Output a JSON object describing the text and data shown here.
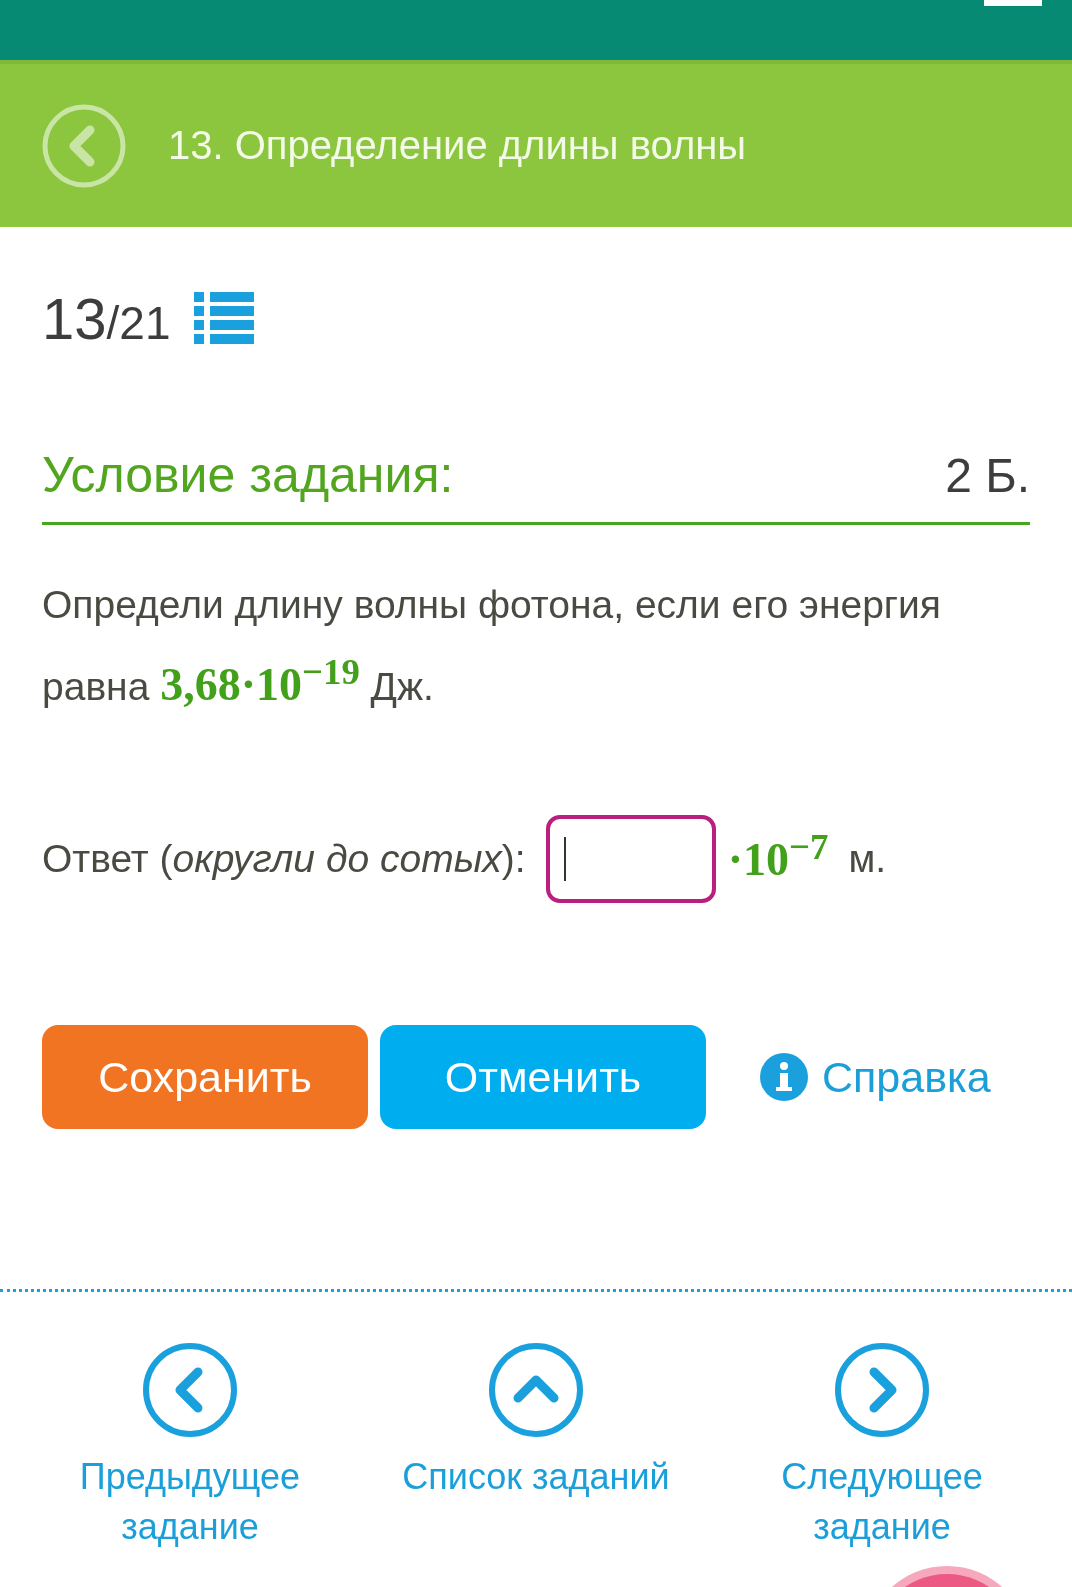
{
  "header": {
    "title": "13. Определение длины волны"
  },
  "progress": {
    "current": "13",
    "total": "/21"
  },
  "condition": {
    "heading": "Условие задания:",
    "points": "2 Б."
  },
  "question": "Определи длину волны фотона, если его энергия равна **3,68·10$^{−19}$** Дж.",
  "answer": {
    "label": "Ответ (*округли до сотых*):",
    "multiplier": "·10$^{−7}$",
    "unit": "м."
  },
  "buttons": [
    {
      "label": "Сохранить",
      "kind": "primary"
    },
    {
      "label": "Отменить",
      "kind": "secondary"
    }
  ],
  "help": {
    "label": "Справка"
  },
  "nav": [
    {
      "label": "Предыдущее задание",
      "kind": "prev"
    },
    {
      "label": "Список заданий",
      "kind": "list"
    },
    {
      "label": "Следующее задание",
      "kind": "next"
    }
  ]
}
